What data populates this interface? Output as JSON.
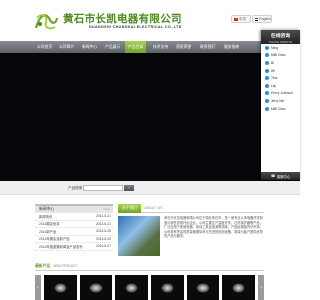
{
  "header": {
    "company_cn": "黄石市长凯电器有限公司",
    "company_en": "HUANGSHI CHANGKAI ELECTRICAL CO.,LTD",
    "lang_cn": "中文",
    "lang_en": "English"
  },
  "nav": {
    "items": [
      "公司首页",
      "公司简介",
      "新闻中心",
      "产品展示",
      "产品目录",
      "技术支持",
      "资质荣誉",
      "联系我们",
      "服务指南"
    ],
    "active_index": 4
  },
  "sidebar": {
    "title": "在线咨询",
    "subtitle": "ONLINE SERVICE",
    "contacts": [
      "Ming",
      "Miffi Zhao",
      "Bi",
      "Wi",
      "Tina",
      "Lily",
      "Percy Johnson",
      "Jerry Nie",
      "Miffi Zhao"
    ],
    "footer": "客服中心"
  },
  "search": {
    "label": "产品搜索",
    "placeholder": "",
    "button": "›"
  },
  "news": {
    "title": "新闻中心",
    "more": "more",
    "items": [
      {
        "title": "新闻快讯",
        "date": "2014-5-21"
      },
      {
        "title": "2014展会信息",
        "date": "2014-5-21"
      },
      {
        "title": "2014新产品",
        "date": "2014-5-20"
      },
      {
        "title": "2013年展会及新产品",
        "date": "2014-5-20"
      },
      {
        "title": "2013年度重要新闻及产品发布",
        "date": "2014-5-07"
      }
    ]
  },
  "about": {
    "title": "关于我们",
    "subtitle": "ABOUT US",
    "text": "黄石市长凯电器有限公司位于湖北黄石市，是一家专业从事电器开关制造与销售的现代化企业。公司主要生产温度开关、过热保护器等产品，广泛应用于家用电器、电动工具及电源等领域，产品远销国内外市场。公司具有完善的质量管理体系与先进的检测设备，竭诚为客户提供优质的产品与服务。"
  },
  "products": {
    "title": "最新产品",
    "subtitle": "NEW PRODUCT",
    "count": 6
  }
}
